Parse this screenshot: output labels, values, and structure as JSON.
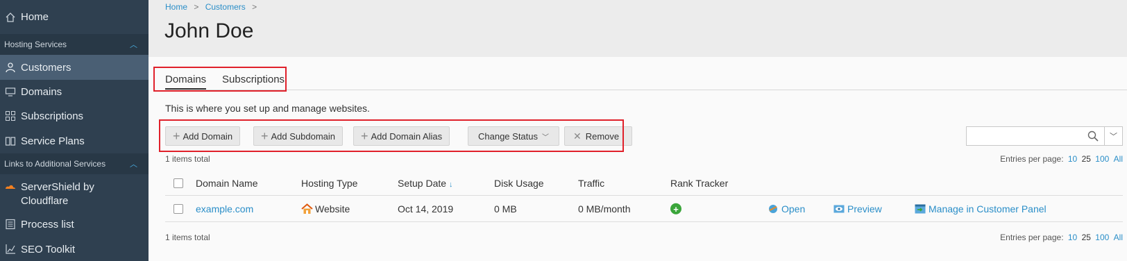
{
  "sidebar": {
    "home": "Home",
    "hosting_group": "Hosting Services",
    "customers": "Customers",
    "domains": "Domains",
    "subscriptions": "Subscriptions",
    "service_plans": "Service Plans",
    "links_group": "Links to Additional Services",
    "servershield_line1": "ServerShield by",
    "servershield_line2": "Cloudflare",
    "process_list": "Process list",
    "seo_toolkit": "SEO Toolkit"
  },
  "breadcrumb": {
    "home": "Home",
    "customers": "Customers"
  },
  "page_title": "John Doe",
  "tabs": {
    "domains": "Domains",
    "subscriptions": "Subscriptions"
  },
  "description": "This is where you set up and manage websites.",
  "toolbar": {
    "add_domain": "Add Domain",
    "add_subdomain": "Add Subdomain",
    "add_domain_alias": "Add Domain Alias",
    "change_status": "Change Status",
    "remove": "Remove"
  },
  "search": {
    "placeholder": ""
  },
  "pagination": {
    "items_total": "1 items total",
    "entries_label": "Entries per page:",
    "opt_10": "10",
    "opt_25": "25",
    "opt_100": "100",
    "opt_all": "All"
  },
  "table": {
    "headers": {
      "domain_name": "Domain Name",
      "hosting_type": "Hosting Type",
      "setup_date": "Setup Date",
      "disk_usage": "Disk Usage",
      "traffic": "Traffic",
      "rank_tracker": "Rank Tracker"
    },
    "rows": [
      {
        "domain": "example.com",
        "hosting_type": "Website",
        "setup_date": "Oct 14, 2019",
        "disk_usage": "0 MB",
        "traffic": "0 MB/month",
        "open": "Open",
        "preview": "Preview",
        "manage": "Manage in Customer Panel"
      }
    ]
  },
  "colors": {
    "accent": "#2a8ec8",
    "highlight": "#e0202a",
    "sidebar": "#2f4050"
  }
}
